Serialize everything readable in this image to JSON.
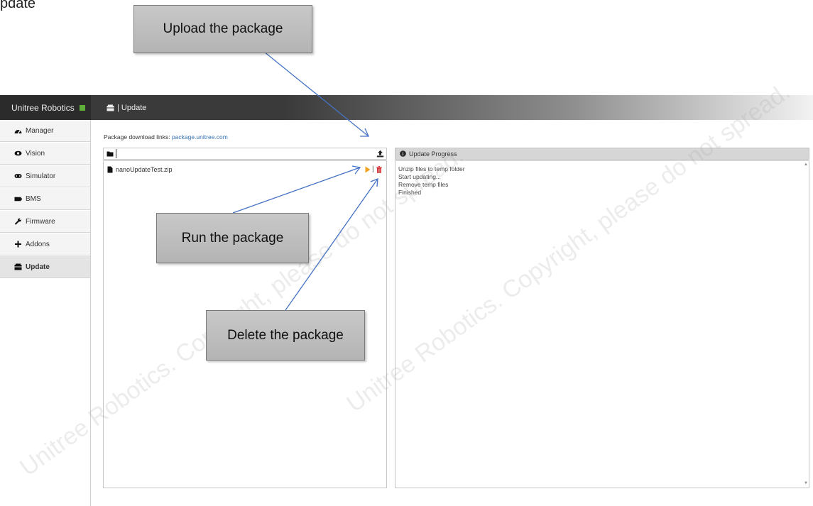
{
  "heading_fragment": "pdate",
  "app": {
    "brand": "Unitree Robotics",
    "page_title": "| Update"
  },
  "sidebar": {
    "items": [
      {
        "label": "Manager",
        "icon": "dashboard-icon"
      },
      {
        "label": "Vision",
        "icon": "eye-icon"
      },
      {
        "label": "Simulator",
        "icon": "gamepad-icon"
      },
      {
        "label": "BMS",
        "icon": "battery-icon"
      },
      {
        "label": "Firmware",
        "icon": "wrench-icon"
      },
      {
        "label": "Addons",
        "icon": "plus-icon"
      },
      {
        "label": "Update",
        "icon": "package-icon",
        "active": true
      }
    ]
  },
  "main": {
    "download_label": "Package download links:",
    "download_link": "package.unitree.com",
    "files": [
      {
        "name": "nanoUpdateTest.zip"
      }
    ],
    "action_separator": "|"
  },
  "progress": {
    "title": "Update Progress",
    "log": [
      "Unzip files to temp folder",
      "Start updating...",
      "Remove temp files",
      "Finished"
    ]
  },
  "callouts": {
    "upload": "Upload the package",
    "run": "Run the package",
    "delete": "Delete the package"
  },
  "watermark_text": "Unitree Robotics. Copyright, please do not spread.",
  "colors": {
    "accent": "#f0a020",
    "danger": "#d03030",
    "link": "#3572b0",
    "status_dot": "#5fae3a",
    "arrow": "#4472c4"
  }
}
